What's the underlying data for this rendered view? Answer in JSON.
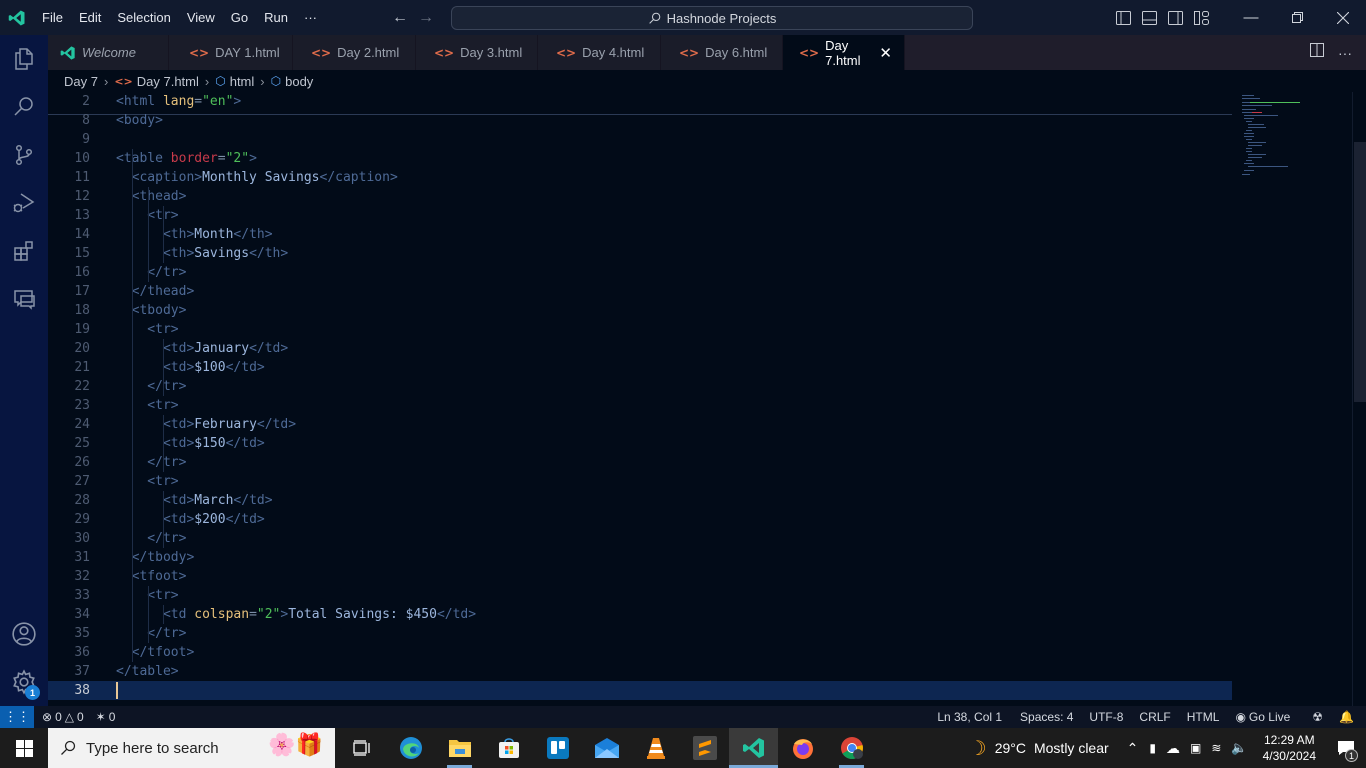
{
  "titlebar": {
    "menu": [
      "File",
      "Edit",
      "Selection",
      "View",
      "Go",
      "Run",
      "···"
    ],
    "command_center": "Hashnode Projects",
    "window_controls": [
      "minimize-icon",
      "restore-icon",
      "close-icon"
    ],
    "layout_icons": [
      "toggle-primary-sidebar-icon",
      "toggle-panel-icon",
      "toggle-secondary-sidebar-icon",
      "customize-layout-icon"
    ]
  },
  "activity_bar": {
    "items": [
      "explorer-icon",
      "search-icon",
      "source-control-icon",
      "run-debug-icon",
      "extensions-icon",
      "remote-explorer-icon"
    ],
    "bottom": [
      "accounts-icon",
      "manage-gear-icon"
    ],
    "manage_badge": "1"
  },
  "tabs": [
    {
      "label": "Welcome",
      "type": "welcome"
    },
    {
      "label": "DAY 1.html",
      "type": "html"
    },
    {
      "label": "Day 2.html",
      "type": "html"
    },
    {
      "label": "Day 3.html",
      "type": "html"
    },
    {
      "label": "Day 4.html",
      "type": "html"
    },
    {
      "label": "Day 6.html",
      "type": "html"
    },
    {
      "label": "Day 7.html",
      "type": "html",
      "active": true
    }
  ],
  "breadcrumb": [
    "Day 7",
    "Day 7.html",
    "html",
    "body"
  ],
  "editor": {
    "sticky": [
      {
        "n": "2",
        "parts": [
          [
            "t",
            "<html "
          ],
          [
            "attr-yel",
            "lang"
          ],
          [
            "eq",
            "="
          ],
          [
            "str",
            "\"en\""
          ],
          [
            "t",
            ">"
          ]
        ]
      },
      {
        "n": "8",
        "parts": [
          [
            "t",
            "<body>"
          ]
        ]
      }
    ],
    "lines": [
      {
        "n": "9",
        "parts": []
      },
      {
        "n": "10",
        "parts": [
          [
            "t",
            "<table "
          ],
          [
            "attr-red",
            "border"
          ],
          [
            "eq",
            "="
          ],
          [
            "str",
            "\"2\""
          ],
          [
            "t",
            ">"
          ]
        ]
      },
      {
        "n": "11",
        "parts": [
          [
            "t",
            "  <caption>"
          ],
          [
            "txt",
            "Monthly Savings"
          ],
          [
            "t",
            "</caption>"
          ]
        ]
      },
      {
        "n": "12",
        "parts": [
          [
            "t",
            "  <thead>"
          ]
        ]
      },
      {
        "n": "13",
        "parts": [
          [
            "t",
            "    <tr>"
          ]
        ]
      },
      {
        "n": "14",
        "parts": [
          [
            "t",
            "      <th>"
          ],
          [
            "txt",
            "Month"
          ],
          [
            "t",
            "</th>"
          ]
        ]
      },
      {
        "n": "15",
        "parts": [
          [
            "t",
            "      <th>"
          ],
          [
            "txt",
            "Savings"
          ],
          [
            "t",
            "</th>"
          ]
        ]
      },
      {
        "n": "16",
        "parts": [
          [
            "t",
            "    </tr>"
          ]
        ]
      },
      {
        "n": "17",
        "parts": [
          [
            "t",
            "  </thead>"
          ]
        ]
      },
      {
        "n": "18",
        "parts": [
          [
            "t",
            "  <tbody>"
          ]
        ]
      },
      {
        "n": "19",
        "parts": [
          [
            "t",
            "    <tr>"
          ]
        ]
      },
      {
        "n": "20",
        "parts": [
          [
            "t",
            "      <td>"
          ],
          [
            "txt",
            "January"
          ],
          [
            "t",
            "</td>"
          ]
        ]
      },
      {
        "n": "21",
        "parts": [
          [
            "t",
            "      <td>"
          ],
          [
            "txt",
            "$100"
          ],
          [
            "t",
            "</td>"
          ]
        ]
      },
      {
        "n": "22",
        "parts": [
          [
            "t",
            "    </tr>"
          ]
        ]
      },
      {
        "n": "23",
        "parts": [
          [
            "t",
            "    <tr>"
          ]
        ]
      },
      {
        "n": "24",
        "parts": [
          [
            "t",
            "      <td>"
          ],
          [
            "txt",
            "February"
          ],
          [
            "t",
            "</td>"
          ]
        ]
      },
      {
        "n": "25",
        "parts": [
          [
            "t",
            "      <td>"
          ],
          [
            "txt",
            "$150"
          ],
          [
            "t",
            "</td>"
          ]
        ]
      },
      {
        "n": "26",
        "parts": [
          [
            "t",
            "    </tr>"
          ]
        ]
      },
      {
        "n": "27",
        "parts": [
          [
            "t",
            "    <tr>"
          ]
        ]
      },
      {
        "n": "28",
        "parts": [
          [
            "t",
            "      <td>"
          ],
          [
            "txt",
            "March"
          ],
          [
            "t",
            "</td>"
          ]
        ]
      },
      {
        "n": "29",
        "parts": [
          [
            "t",
            "      <td>"
          ],
          [
            "txt",
            "$200"
          ],
          [
            "t",
            "</td>"
          ]
        ]
      },
      {
        "n": "30",
        "parts": [
          [
            "t",
            "    </tr>"
          ]
        ]
      },
      {
        "n": "31",
        "parts": [
          [
            "t",
            "  </tbody>"
          ]
        ]
      },
      {
        "n": "32",
        "parts": [
          [
            "t",
            "  <tfoot>"
          ]
        ]
      },
      {
        "n": "33",
        "parts": [
          [
            "t",
            "    <tr>"
          ]
        ]
      },
      {
        "n": "34",
        "parts": [
          [
            "t",
            "      <td "
          ],
          [
            "attr-yel",
            "colspan"
          ],
          [
            "eq",
            "="
          ],
          [
            "str",
            "\"2\""
          ],
          [
            "t",
            ">"
          ],
          [
            "txt",
            "Total Savings: $450"
          ],
          [
            "t",
            "</td>"
          ]
        ]
      },
      {
        "n": "35",
        "parts": [
          [
            "t",
            "    </tr>"
          ]
        ]
      },
      {
        "n": "36",
        "parts": [
          [
            "t",
            "  </tfoot>"
          ]
        ]
      },
      {
        "n": "37",
        "parts": [
          [
            "t",
            "</table>"
          ]
        ]
      },
      {
        "n": "38",
        "parts": [],
        "current": true
      }
    ]
  },
  "statusbar": {
    "errors": "0",
    "warnings": "0",
    "ports": "0",
    "position": "Ln 38, Col 1",
    "spaces": "Spaces: 4",
    "encoding": "UTF-8",
    "eol": "CRLF",
    "language": "HTML",
    "go_live": "Go Live"
  },
  "taskbar": {
    "search_placeholder": "Type here to search",
    "apps": [
      "task-view",
      "edge",
      "file-explorer",
      "microsoft-store",
      "trello",
      "mail",
      "vlc",
      "sublime-text",
      "vscode",
      "firefox",
      "chrome"
    ],
    "weather_temp": "29°C",
    "weather_desc": "Mostly clear",
    "time": "12:29 AM",
    "date": "4/30/2024",
    "notification_count": "1"
  },
  "colors": {
    "accent": "#0a5fb0",
    "editor_bg": "#020b18",
    "activity_bg": "#071540",
    "html_icon": "#e06c4b"
  }
}
